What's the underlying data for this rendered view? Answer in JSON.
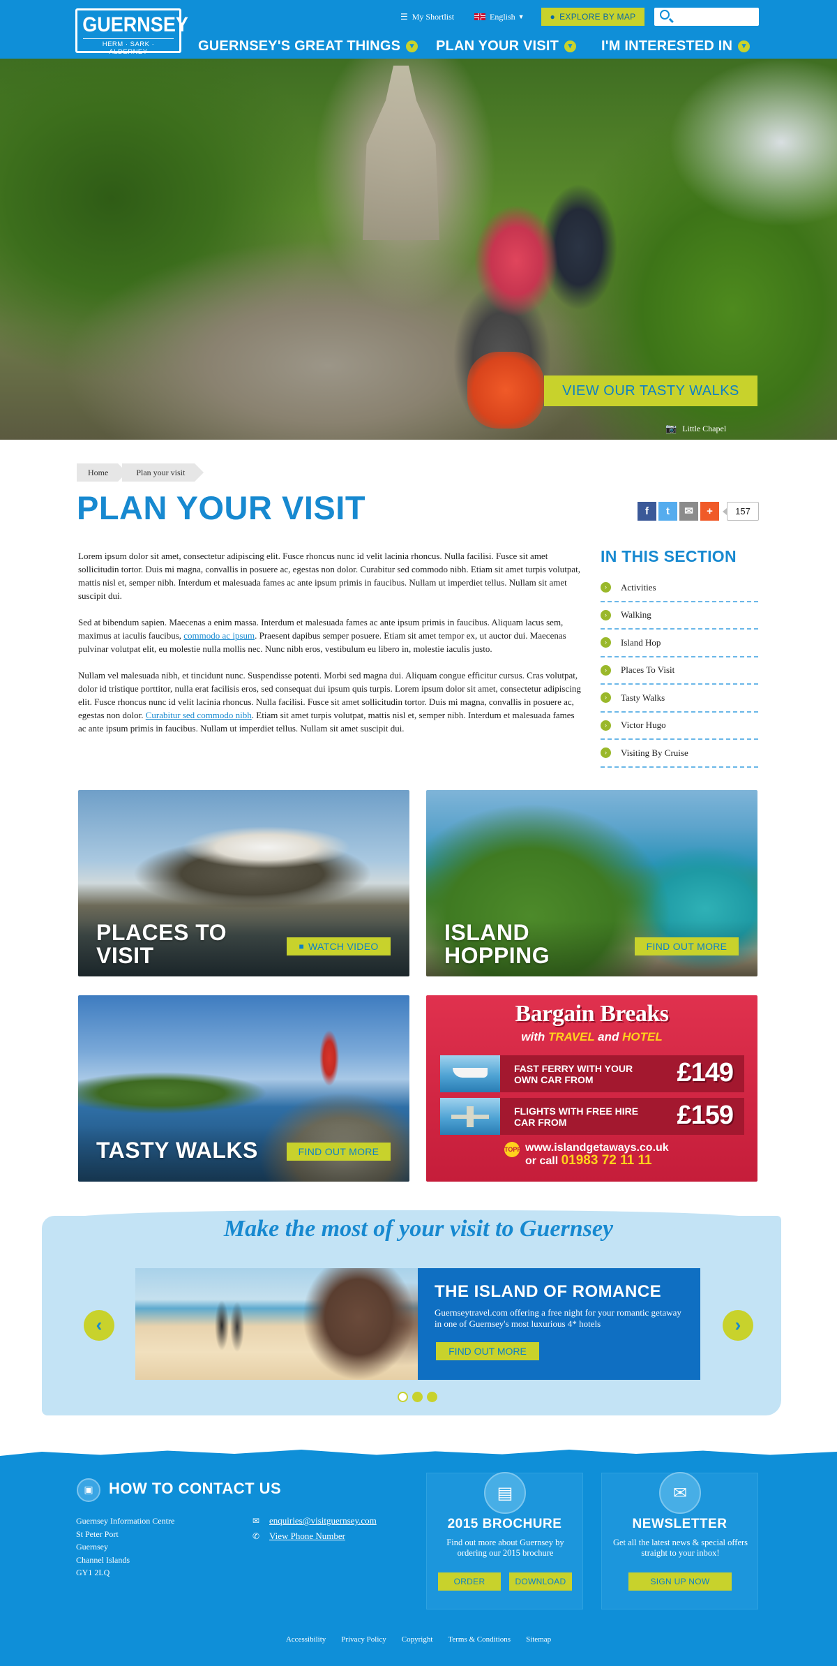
{
  "header": {
    "logo_main": "GUERNSEY",
    "logo_sub": "HERM · SARK · ALDERNEY",
    "shortlist_label": "My Shortlist",
    "language_label": "English",
    "explore_label": "EXPLORE BY MAP",
    "search_placeholder": "",
    "nav": [
      {
        "label": "GUERNSEY'S GREAT THINGS"
      },
      {
        "label": "PLAN YOUR VISIT"
      },
      {
        "label": "I'M INTERESTED IN"
      }
    ]
  },
  "hero": {
    "button_label": "VIEW OUR TASTY WALKS",
    "caption": "Little Chapel"
  },
  "breadcrumb": [
    "Home",
    "Plan your visit"
  ],
  "page": {
    "title": "PLAN YOUR VISIT",
    "share_count": "157",
    "paragraphs": [
      {
        "text": "Lorem ipsum dolor sit amet, consectetur adipiscing elit. Fusce rhoncus nunc id velit lacinia rhoncus. Nulla facilisi. Fusce sit amet sollicitudin tortor. Duis mi magna, convallis in posuere ac, egestas non dolor. Curabitur sed commodo nibh. Etiam sit amet turpis volutpat, mattis nisl et, semper nibh. Interdum et malesuada fames ac ante ipsum primis in faucibus. Nullam ut imperdiet tellus. Nullam sit amet suscipit dui."
      },
      {
        "before": "Sed at bibendum sapien. Maecenas a enim massa. Interdum et malesuada fames ac ante ipsum primis in faucibus. Aliquam lacus sem, maximus at iaculis faucibus, ",
        "link": "commodo ac ipsum",
        "after": ". Praesent dapibus semper posuere. Etiam sit amet tempor ex, ut auctor dui. Maecenas pulvinar volutpat elit, eu molestie nulla mollis nec. Nunc nibh eros, vestibulum eu libero in, molestie iaculis justo."
      },
      {
        "before": "Nullam vel malesuada nibh, et tincidunt nunc. Suspendisse potenti. Morbi sed magna dui. Aliquam congue efficitur cursus. Cras volutpat, dolor id tristique porttitor, nulla erat facilisis eros, sed consequat dui ipsum quis turpis. Lorem ipsum dolor sit amet, consectetur adipiscing elit. Fusce rhoncus nunc id velit lacinia rhoncus. Nulla facilisi. Fusce sit amet sollicitudin tortor. Duis mi magna, convallis in posuere ac, egestas non dolor. ",
        "link": "Curabitur sed commodo nibh",
        "after": ". Etiam sit amet turpis volutpat, mattis nisl et, semper nibh. Interdum et malesuada fames ac ante ipsum primis in faucibus. Nullam ut imperdiet tellus. Nullam sit amet suscipit dui."
      }
    ]
  },
  "sidebar": {
    "title": "IN THIS SECTION",
    "items": [
      {
        "label": "Activities"
      },
      {
        "label": "Walking"
      },
      {
        "label": "Island Hop"
      },
      {
        "label": "Places To Visit"
      },
      {
        "label": "Tasty Walks"
      },
      {
        "label": "Victor Hugo"
      },
      {
        "label": "Visiting By Cruise"
      }
    ]
  },
  "tiles": {
    "places": {
      "title": "PLACES TO VISIT",
      "button": "WATCH VIDEO"
    },
    "island": {
      "title": "ISLAND HOPPING",
      "button": "FIND OUT MORE"
    },
    "walks": {
      "title": "TASTY WALKS",
      "button": "FIND OUT MORE"
    },
    "ad": {
      "title": "Bargain Breaks",
      "sub_with": "with ",
      "sub_travel": "TRAVEL",
      "sub_and": " and ",
      "sub_hotel": "HOTEL",
      "rows": [
        {
          "text": "FAST FERRY WITH YOUR OWN CAR FROM",
          "price": "£149"
        },
        {
          "text": "FLIGHTS WITH FREE HIRE CAR FROM",
          "price": "£159"
        }
      ],
      "logo": "TOPP",
      "website": "www.islandgetaways.co.uk",
      "call_prefix": "or call ",
      "phone": "01983 72 11 11"
    }
  },
  "promo": {
    "heading": "Make the most of your visit to Guernsey",
    "slide": {
      "title": "THE ISLAND OF ROMANCE",
      "text": "Guernseytravel.com offering a free night for your romantic getaway in one of Guernsey's most luxurious 4* hotels",
      "button": "FIND OUT MORE"
    },
    "prev_icon": "‹",
    "next_icon": "›",
    "slide_count": 3,
    "active_slide": 1
  },
  "footer": {
    "contact_title": "HOW TO CONTACT US",
    "address": [
      "Guernsey Information Centre",
      "St Peter Port",
      "Guernsey",
      "Channel Islands",
      "GY1 2LQ"
    ],
    "email": "enquiries@visitguernsey.com",
    "phone_link": "View Phone Number",
    "brochure": {
      "title": "2015 BROCHURE",
      "text": "Find out more about Guernsey by ordering our 2015 brochure",
      "order": "ORDER",
      "download": "DOWNLOAD"
    },
    "newsletter": {
      "title": "NEWSLETTER",
      "text": "Get all the latest news & special offers straight to your inbox!",
      "signup": "SIGN UP NOW"
    },
    "links": [
      "Accessibility",
      "Privacy Policy",
      "Copyright",
      "Terms & Conditions",
      "Sitemap"
    ]
  },
  "colors": {
    "brand_blue": "#0f8fd8",
    "accent_lime": "#c8d22c",
    "title_blue": "#1789d0",
    "ad_red": "#c51d3a"
  }
}
